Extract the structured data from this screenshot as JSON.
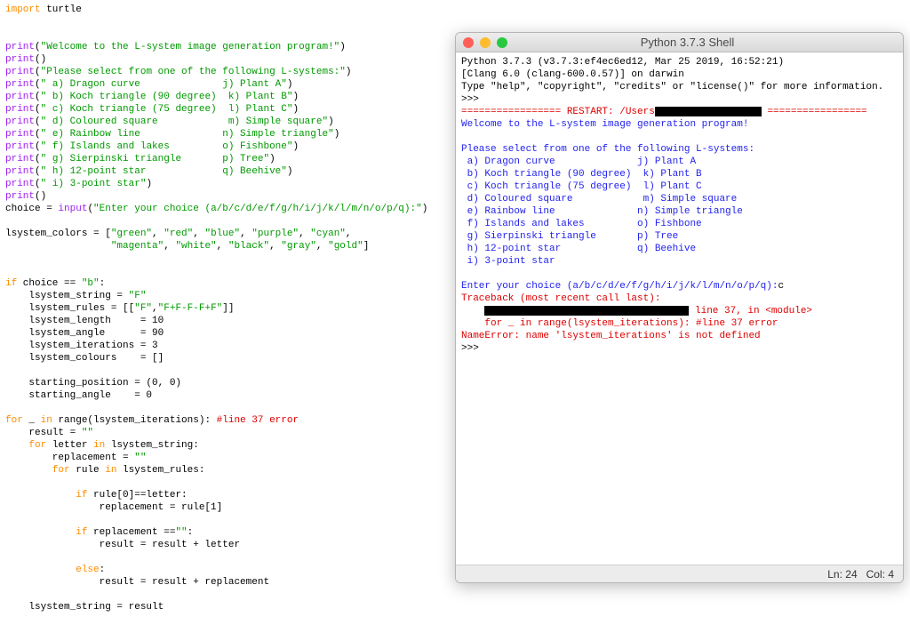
{
  "editor": {
    "line1a": "import",
    "line1b": " turtle",
    "l3a": "print",
    "l3b": "(",
    "l3c": "\"Welcome to the L-system image generation program!\"",
    "l3d": ")",
    "l4a": "print",
    "l4b": "()",
    "l5a": "print",
    "l5b": "(",
    "l5c": "\"Please select from one of the following L-systems:\"",
    "l5d": ")",
    "l6a": "print",
    "l6b": "(",
    "l6c": "\" a) Dragon curve              j) Plant A\"",
    "l6d": ")",
    "l7a": "print",
    "l7b": "(",
    "l7c": "\" b) Koch triangle (90 degree)  k) Plant B\"",
    "l7d": ")",
    "l8a": "print",
    "l8b": "(",
    "l8c": "\" c) Koch triangle (75 degree)  l) Plant C\"",
    "l8d": ")",
    "l9a": "print",
    "l9b": "(",
    "l9c": "\" d) Coloured square            m) Simple square\"",
    "l9d": ")",
    "l10a": "print",
    "l10b": "(",
    "l10c": "\" e) Rainbow line              n) Simple triangle\"",
    "l10d": ")",
    "l11a": "print",
    "l11b": "(",
    "l11c": "\" f) Islands and lakes         o) Fishbone\"",
    "l11d": ")",
    "l12a": "print",
    "l12b": "(",
    "l12c": "\" g) Sierpinski triangle       p) Tree\"",
    "l12d": ")",
    "l13a": "print",
    "l13b": "(",
    "l13c": "\" h) 12-point star             q) Beehive\"",
    "l13d": ")",
    "l14a": "print",
    "l14b": "(",
    "l14c": "\" i) 3-point star\"",
    "l14d": ")",
    "l15a": "print",
    "l15b": "()",
    "l16a": "choice = ",
    "l16b": "input",
    "l16c": "(",
    "l16d": "\"Enter your choice (a/b/c/d/e/f/g/h/i/j/k/l/m/n/o/p/q):\"",
    "l16e": ")",
    "l18a": "lsystem_colors = [",
    "l18b": "\"green\"",
    "l18c": ", ",
    "l18d": "\"red\"",
    "l18e": ", ",
    "l18f": "\"blue\"",
    "l18g": ", ",
    "l18h": "\"purple\"",
    "l18i": ", ",
    "l18j": "\"cyan\"",
    "l18k": ",",
    "l19a": "                  ",
    "l19b": "\"magenta\"",
    "l19c": ", ",
    "l19d": "\"white\"",
    "l19e": ", ",
    "l19f": "\"black\"",
    "l19g": ", ",
    "l19h": "\"gray\"",
    "l19i": ", ",
    "l19j": "\"gold\"",
    "l19k": "]",
    "l22a": "if",
    "l22b": " choice == ",
    "l22c": "\"b\"",
    "l22d": ":",
    "l23": "    lsystem_string = \"F\"",
    "l23a": "    lsystem_string = ",
    "l23b": "\"F\"",
    "l24a": "    lsystem_rules = [[",
    "l24b": "\"F\"",
    "l24c": ",",
    "l24d": "\"F+F-F-F+F\"",
    "l24e": "]]",
    "l25": "    lsystem_length     = 10",
    "l26": "    lsystem_angle      = 90",
    "l27": "    lsystem_iterations = 3",
    "l28": "    lsystem_colours    = []",
    "l30": "    starting_position = (0, 0)",
    "l31": "    starting_angle    = 0",
    "l33a": "for",
    "l33b": " _ ",
    "l33c": "in",
    "l33d": " range(lsystem_iterations): ",
    "l33e": "#line 37 error",
    "l34a": "    result = ",
    "l34b": "\"\"",
    "l35a": "    ",
    "l35b": "for",
    "l35c": " letter ",
    "l35d": "in",
    "l35e": " lsystem_string:",
    "l36a": "        replacement = ",
    "l36b": "\"\"",
    "l37a": "        ",
    "l37b": "for",
    "l37c": " rule ",
    "l37d": "in",
    "l37e": " lsystem_rules:",
    "l39a": "            ",
    "l39b": "if",
    "l39c": " rule[0]==letter:",
    "l40": "                replacement = rule[1]",
    "l42a": "            ",
    "l42b": "if",
    "l42c": " replacement ==",
    "l42d": "\"\"",
    "l42e": ":",
    "l43": "                result = result + letter",
    "l45a": "            ",
    "l45b": "else",
    "l45c": ":",
    "l46": "                result = result + replacement",
    "l48": "    lsystem_string = result"
  },
  "shell": {
    "title": "Python 3.7.3 Shell",
    "l1": "Python 3.7.3 (v3.7.3:ef4ec6ed12, Mar 25 2019, 16:52:21)",
    "l2": "[Clang 6.0 (clang-600.0.57)] on darwin",
    "l3": "Type \"help\", \"copyright\", \"credits\" or \"license()\" for more information.",
    "l4": ">>>",
    "l5a": "================= RESTART: /Users",
    "l5b": " =================",
    "l6": "Welcome to the L-system image generation program!",
    "l8": "Please select from one of the following L-systems:",
    "l9": " a) Dragon curve              j) Plant A",
    "l10": " b) Koch triangle (90 degree)  k) Plant B",
    "l11": " c) Koch triangle (75 degree)  l) Plant C",
    "l12": " d) Coloured square            m) Simple square",
    "l13": " e) Rainbow line              n) Simple triangle",
    "l14": " f) Islands and lakes         o) Fishbone",
    "l15": " g) Sierpinski triangle       p) Tree",
    "l16": " h) 12-point star             q) Beehive",
    "l17": " i) 3-point star",
    "l19a": "Enter your choice (a/b/c/d/e/f/g/h/i/j/k/l/m/n/o/p/q):",
    "l19b": "c",
    "l20": "Traceback (most recent call last):",
    "l21a": "    ",
    "l21b": " line 37, in <module>",
    "l22": "    for _ in range(lsystem_iterations): #line 37 error",
    "l23": "NameError: name 'lsystem_iterations' is not defined",
    "l24": ">>>",
    "status_ln": "Ln: 24",
    "status_col": "Col: 4"
  }
}
